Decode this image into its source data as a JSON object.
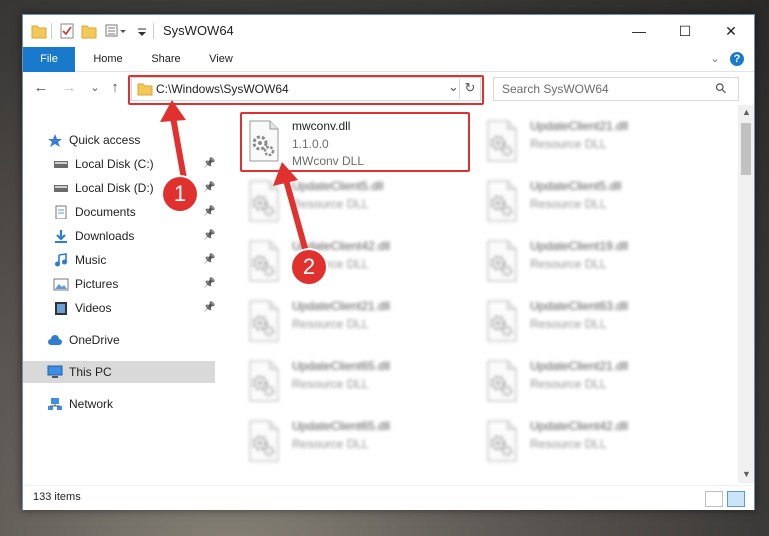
{
  "window": {
    "title": "SysWOW64",
    "minimize": "—",
    "maximize": "☐",
    "close": "✕"
  },
  "ribbon": {
    "tabs": [
      "File",
      "Home",
      "Share",
      "View"
    ],
    "expand": "⌄",
    "help": "?"
  },
  "addressbar": {
    "path": "C:\\Windows\\SysWOW64",
    "dropdown": "⌄",
    "refresh": "↻",
    "back": "←",
    "forward": "→",
    "recent": "⌄",
    "up": "↑"
  },
  "search": {
    "placeholder": "Search SysWOW64",
    "icon": "⚲"
  },
  "sidebar": {
    "items": [
      {
        "label": "Quick access",
        "icon": "star-icon"
      },
      {
        "label": "Local Disk (C:)",
        "icon": "drive-icon",
        "pinned": true
      },
      {
        "label": "Local Disk (D:)",
        "icon": "drive-icon",
        "pinned": true
      },
      {
        "label": "Documents",
        "icon": "documents-icon",
        "pinned": true
      },
      {
        "label": "Downloads",
        "icon": "downloads-icon",
        "pinned": true
      },
      {
        "label": "Music",
        "icon": "music-icon",
        "pinned": true
      },
      {
        "label": "Pictures",
        "icon": "pictures-icon",
        "pinned": true
      },
      {
        "label": "Videos",
        "icon": "videos-icon",
        "pinned": true
      },
      {
        "label": "OneDrive",
        "icon": "cloud-icon"
      },
      {
        "label": "This PC",
        "icon": "computer-icon",
        "selected": true
      },
      {
        "label": "Network",
        "icon": "network-icon"
      }
    ]
  },
  "files": {
    "highlighted": {
      "name": "mwconv.dll",
      "version": "1.1.0.0",
      "description": "MWconv DLL"
    },
    "left": [
      {
        "name": "UpdateClient5.dll",
        "description": "Resource DLL"
      },
      {
        "name": "UpdateClient42.dll",
        "description": "Resource DLL"
      },
      {
        "name": "UpdateClient21.dll",
        "description": "Resource DLL"
      },
      {
        "name": "UpdateClient65.dll",
        "description": "Resource DLL"
      },
      {
        "name": "UpdateClient65.dll",
        "description": "Resource DLL"
      }
    ],
    "right": [
      {
        "name": "UpdateClient21.dll",
        "description": "Resource DLL"
      },
      {
        "name": "UpdateClient5.dll",
        "description": "Resource DLL"
      },
      {
        "name": "UpdateClient19.dll",
        "description": "Resource DLL"
      },
      {
        "name": "UpdateClient63.dll",
        "description": "Resource DLL"
      },
      {
        "name": "UpdateClient21.dll",
        "description": "Resource DLL"
      },
      {
        "name": "UpdateClient42.dll",
        "description": "Resource DLL"
      }
    ]
  },
  "status": {
    "item_count": "133 items"
  },
  "annotations": {
    "step1": "1",
    "step2": "2",
    "color": "#e0312f"
  }
}
